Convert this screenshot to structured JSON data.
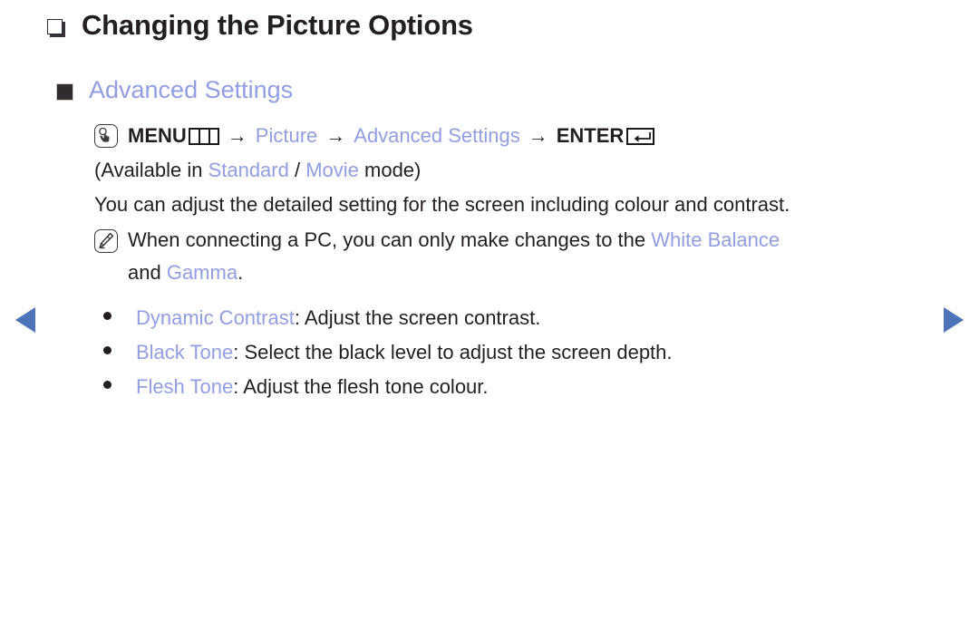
{
  "page": {
    "title": "Changing the Picture Options",
    "section_heading": "Advanced Settings"
  },
  "menu_path": {
    "press_icon": "press-button-icon",
    "menu_label": "MENU",
    "menu_glyph": "menu-bars-icon",
    "separator": "→",
    "step_picture": "Picture",
    "step_advanced_settings": "Advanced Settings",
    "enter_label": "ENTER",
    "enter_glyph": "enter-return-icon"
  },
  "availability": {
    "prefix": "(Available in ",
    "mode_standard": "Standard",
    "divider": " / ",
    "mode_movie": "Movie",
    "suffix": " mode)"
  },
  "description": "You can adjust the detailed setting for the screen including colour and contrast.",
  "note": {
    "icon": "note-pen-icon",
    "text_before": "When connecting a PC, you can only make changes to the ",
    "highlight_1": "White Balance",
    "continuation_before": "and ",
    "highlight_2": "Gamma",
    "continuation_after": "."
  },
  "options": [
    {
      "name": "Dynamic Contrast",
      "separator": ": ",
      "description": "Adjust the screen contrast."
    },
    {
      "name": "Black Tone",
      "separator": ": ",
      "description": "Select the black level to adjust the screen depth."
    },
    {
      "name": "Flesh Tone",
      "separator": ": ",
      "description": "Adjust the flesh tone colour."
    }
  ],
  "navigation": {
    "prev_icon": "triangle-left-icon",
    "next_icon": "triangle-right-icon"
  },
  "colors": {
    "accent": "#919ee2",
    "text": "#231f20",
    "nav_arrow": "#4d73b8"
  }
}
